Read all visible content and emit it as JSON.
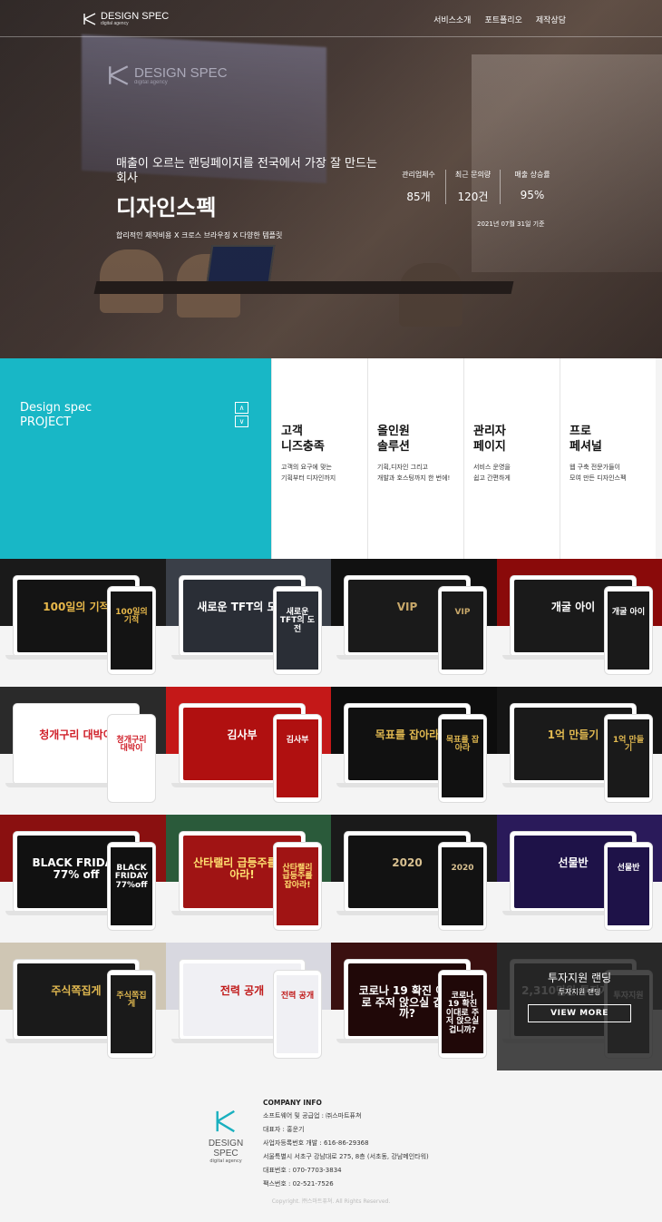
{
  "header": {
    "logo_text": "DESIGN SPEC",
    "logo_sub": "digital agency",
    "nav": [
      "서비스소개",
      "포트폴리오",
      "제작상담"
    ]
  },
  "hero": {
    "bg_logo_text": "DESIGN SPEC",
    "bg_logo_sub": "digital agency",
    "lead": "매출이 오르는 랜딩페이지를 전국에서 가장 잘 만드는 회사",
    "title": "디자인스펙",
    "tags": "합리적인 제작비용 X 크로스 브라우징 X 다양한 템플릿",
    "stats": [
      {
        "label": "관리업체수",
        "value": "85개"
      },
      {
        "label": "최근 문의량",
        "value": "120건"
      },
      {
        "label": "매출 상승률",
        "value": "95%"
      }
    ],
    "stats_date": "2021년 07월 31일 기준"
  },
  "project": {
    "title_line1": "Design spec",
    "title_line2": "PROJECT",
    "arrow_up": "∧",
    "arrow_down": "∨"
  },
  "features": [
    {
      "title": "고객\n니즈충족",
      "desc": "고객의 요구에 맞는\n기획부터 디자인까지"
    },
    {
      "title": "올인원\n솔루션",
      "desc": "기획,디자인 그리고\n개발과 호스팅까지 한 번에!"
    },
    {
      "title": "관리자\n페이지",
      "desc": "서비스 운영을\n쉽고 간편하게"
    },
    {
      "title": "프로\n페셔널",
      "desc": "웹 구축 전문가들이\n모여 만든 디자인스펙"
    }
  ],
  "portfolio": [
    {
      "headline": "100일의 기적",
      "phone": "100일의 기적",
      "bg": "#1a1a1a",
      "scr": "#141414",
      "fg": "#e8b84a"
    },
    {
      "headline": "새로운 TFT의 도전",
      "phone": "새로운 TFT의 도전",
      "bg": "#3a3f48",
      "scr": "#2a2e36",
      "fg": "#ffffff"
    },
    {
      "headline": "VIP",
      "phone": "VIP",
      "bg": "#111111",
      "scr": "#1a1a1a",
      "fg": "#c8a86a"
    },
    {
      "headline": "개굴 아이",
      "phone": "개굴 아이",
      "bg": "#8a0a0a",
      "scr": "#1a1a1a",
      "fg": "#ffffff"
    },
    {
      "headline": "청개구리 대박이",
      "phone": "청개구리 대박이",
      "bg": "#2a2a2a",
      "scr": "#ffffff",
      "fg": "#d0202a"
    },
    {
      "headline": "김사부",
      "phone": "김사부",
      "bg": "#c41818",
      "scr": "#b01010",
      "fg": "#ffffff"
    },
    {
      "headline": "목표를 잡아라",
      "phone": "목표를 잡아라",
      "bg": "#0d0d0d",
      "scr": "#111111",
      "fg": "#e0b850"
    },
    {
      "headline": "1억 만들기",
      "phone": "1억 만들기",
      "bg": "#151515",
      "scr": "#1a1a1a",
      "fg": "#e0b850"
    },
    {
      "headline": "BLACK FRIDAY 77% off",
      "phone": "BLACK FRIDAY 77%off",
      "bg": "#8a1010",
      "scr": "#111111",
      "fg": "#ffffff"
    },
    {
      "headline": "산타랠리 급등주를 잡아라!",
      "phone": "산타랠리 급등주를 잡아라!",
      "bg": "#2a5a3a",
      "scr": "#a01414",
      "fg": "#ffe070"
    },
    {
      "headline": "2020",
      "phone": "2020",
      "bg": "#1a1a1a",
      "scr": "#121212",
      "fg": "#d8c090"
    },
    {
      "headline": "선물반",
      "phone": "선물반",
      "bg": "#2a1a5a",
      "scr": "#1e1248",
      "fg": "#ffffff"
    },
    {
      "headline": "주식쪽집게",
      "phone": "주식쪽집게",
      "bg": "#cfc6b4",
      "scr": "#1a1a1a",
      "fg": "#e0b850"
    },
    {
      "headline": "전력 공개",
      "phone": "전력 공개",
      "bg": "#d8d8e0",
      "scr": "#f0f0f4",
      "fg": "#c01818"
    },
    {
      "headline": "코로나 19 확진 이대로 주저 앉으실 겁니까?",
      "phone": "코로나 19 확진 이대로 주저 앉으실 겁니까?",
      "bg": "#3a1010",
      "scr": "#200808",
      "fg": "#ffffff"
    },
    {
      "headline": "2,310만원 투자지원!",
      "phone": "투자지원",
      "bg": "#2a2a2a",
      "scr": "#1a1a1a",
      "fg": "#ffffff",
      "overlay_title": "투자지원 랜딩",
      "overlay_sub": "투자지원 랜딩",
      "overlay_btn": "VIEW MORE"
    }
  ],
  "footer": {
    "logo_text": "DESIGN SPEC",
    "logo_sub": "digital agency",
    "info_title": "COMPANY INFO",
    "lines": [
      "소프트웨어 및 공급업 : ㈜스마트퓨쳐",
      "대표자 : 홍운기",
      "사업자등록번호 개발 : 616-86-29368",
      "서울특별시 서초구 강남대로 275, 8층 (서초동, 강남메인타워)",
      "대표번호 : 070-7703-3834",
      "팩스번호 : 02-521-7526"
    ],
    "copyright": "Copyright. ㈜스마트퓨쳐. All Rights Reserved."
  }
}
